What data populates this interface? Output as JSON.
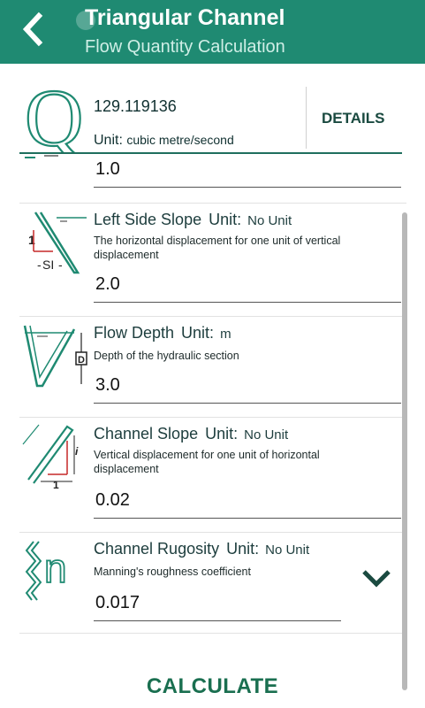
{
  "header": {
    "title": "Triangular Channel",
    "subtitle": "Flow Quantity Calculation",
    "back_icon": "chevron-left-icon",
    "bg_color": "#1f8a72"
  },
  "result": {
    "symbol": "Q",
    "value": "129.119136",
    "unit_label": "Unit:",
    "unit_value": "cubic metre/second",
    "details_label": "DETAILS"
  },
  "fields": [
    {
      "input_value": "1.0"
    },
    {
      "label": "Left Side Slope",
      "unit_label": "Unit:",
      "unit_value": "No Unit",
      "description": "The horizontal displacement for one unit of vertical displacement",
      "input_value": "2.0",
      "icon": "side-slope-icon",
      "icon_text": "SI"
    },
    {
      "label": "Flow Depth",
      "unit_label": "Unit:",
      "unit_value": "m",
      "description": "Depth of the hydraulic section",
      "input_value": "3.0",
      "icon": "flow-depth-icon",
      "icon_text": "D"
    },
    {
      "label": "Channel Slope",
      "unit_label": "Unit:",
      "unit_value": "No Unit",
      "description": "Vertical displacement for one unit of horizontal displacement",
      "input_value": "0.02",
      "icon": "channel-slope-icon",
      "icon_text": "i"
    },
    {
      "label": "Channel Rugosity",
      "unit_label": "Unit:",
      "unit_value": "No Unit",
      "description": "Manning's roughness coefficient",
      "input_value": "0.017",
      "icon": "rugosity-icon",
      "icon_text": "n"
    }
  ],
  "expand_icon": "chevron-down-icon",
  "calculate_label": "CALCULATE",
  "accent": "#1f8a72"
}
